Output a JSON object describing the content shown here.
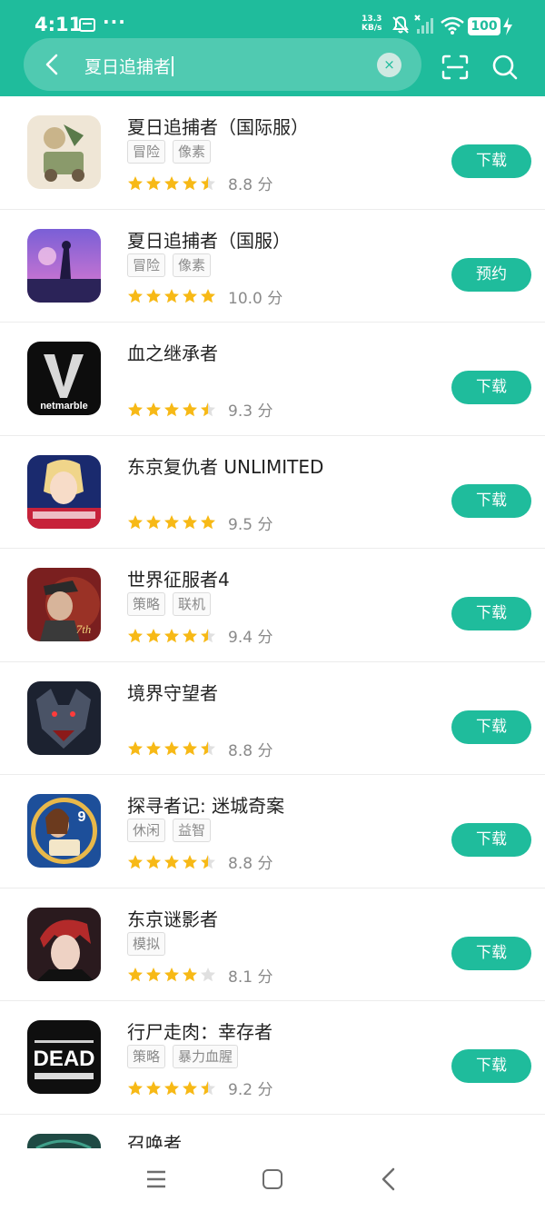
{
  "status_bar": {
    "time": "4:11",
    "extra": "···",
    "net_speed_value": "13.3",
    "net_speed_unit": "KB/s",
    "battery": "100"
  },
  "search": {
    "query": "夏日追捕者",
    "clear_symbol": "×"
  },
  "colors": {
    "accent": "#1fbc9c",
    "star": "#f7b916",
    "star_empty": "#e0e0e0"
  },
  "apps": [
    {
      "name": "夏日追捕者（国际服）",
      "tags": [
        "冒险",
        "像素"
      ],
      "stars": 4.5,
      "score": "8.8 分",
      "action": "下载"
    },
    {
      "name": "夏日追捕者（国服）",
      "tags": [
        "冒险",
        "像素"
      ],
      "stars": 5,
      "score": "10.0 分",
      "action": "预约"
    },
    {
      "name": "血之继承者",
      "tags": [],
      "stars": 4.5,
      "score": "9.3 分",
      "action": "下载",
      "icon_text": "netmarble"
    },
    {
      "name": "东京复仇者 UNLIMITED",
      "tags": [],
      "stars": 5,
      "score": "9.5 分",
      "action": "下载"
    },
    {
      "name": "世界征服者4",
      "tags": [
        "策略",
        "联机"
      ],
      "stars": 4.5,
      "score": "9.4 分",
      "action": "下载",
      "icon_text": "7th"
    },
    {
      "name": "境界守望者",
      "tags": [],
      "stars": 4.5,
      "score": "8.8 分",
      "action": "下载"
    },
    {
      "name": "探寻者记: 迷城奇案",
      "tags": [
        "休闲",
        "益智"
      ],
      "stars": 4.5,
      "score": "8.8 分",
      "action": "下载",
      "icon_text": "9"
    },
    {
      "name": "东京谜影者",
      "tags": [
        "模拟"
      ],
      "stars": 4,
      "score": "8.1 分",
      "action": "下载"
    },
    {
      "name": "行尸走肉：幸存者",
      "tags": [
        "策略",
        "暴力血腥"
      ],
      "stars": 4.5,
      "score": "9.2 分",
      "action": "下载",
      "icon_text": "DEAD"
    }
  ],
  "partial_app": {
    "name": "召唤者"
  },
  "nav": {
    "menu_icon": "menu-icon",
    "home_icon": "home-icon",
    "back_icon": "back-icon"
  }
}
